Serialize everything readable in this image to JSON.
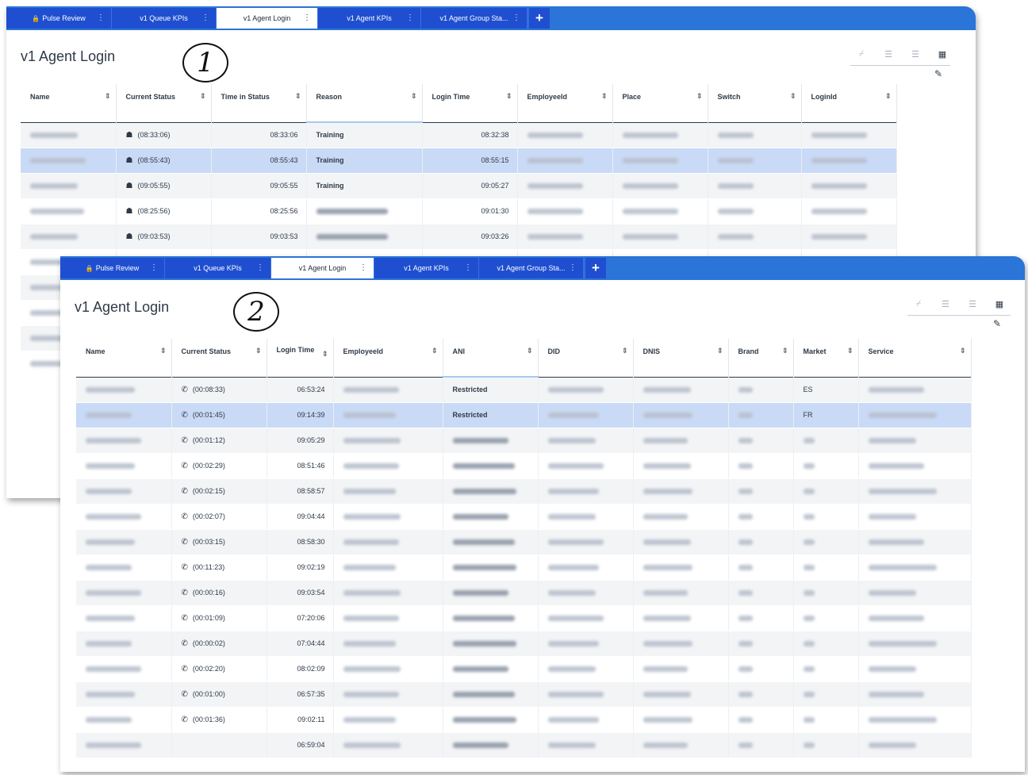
{
  "tabs": [
    {
      "label": "Pulse Review",
      "locked": true
    },
    {
      "label": "v1 Queue KPIs"
    },
    {
      "label": "v1 Agent Login",
      "active": true
    },
    {
      "label": "v1 Agent KPIs"
    },
    {
      "label": "v1 Agent Group Sta..."
    }
  ],
  "tab_add": "+",
  "tab_menu_glyph": "⋮",
  "lock_glyph": "🔒",
  "page_title": "v1 Agent Login",
  "markers": [
    "1",
    "2"
  ],
  "toolbar_icons": [
    "line-chart-icon",
    "bar-chart-icon",
    "stacked-bar-icon",
    "grid-view-icon",
    "pencil-icon"
  ],
  "panel1": {
    "columns": [
      "Name",
      "Current Status",
      "Time in Status",
      "Reason",
      "Login Time",
      "EmployeeId",
      "Place",
      "Switch",
      "LoginId"
    ],
    "rows": [
      {
        "status": "(08:33:06)",
        "time_in_status": "08:33:06",
        "reason": "Training",
        "login_time": "08:32:38"
      },
      {
        "status": "(08:55:43)",
        "time_in_status": "08:55:43",
        "reason": "Training",
        "login_time": "08:55:15",
        "selected": true
      },
      {
        "status": "(09:05:55)",
        "time_in_status": "09:05:55",
        "reason": "Training",
        "login_time": "09:05:27"
      },
      {
        "status": "(08:25:56)",
        "time_in_status": "08:25:56",
        "reason": "",
        "login_time": "09:01:30"
      },
      {
        "status": "(09:03:53)",
        "time_in_status": "09:03:53",
        "reason": "",
        "login_time": "09:03:26"
      }
    ]
  },
  "panel2": {
    "columns": [
      "Name",
      "Current Status",
      "Login Time",
      "EmployeeId",
      "ANI",
      "DID",
      "DNIS",
      "Brand",
      "Market",
      "Service"
    ],
    "rows": [
      {
        "status": "(00:08:33)",
        "login_time": "06:53:24",
        "ani": "Restricted",
        "market": "ES"
      },
      {
        "status": "(00:01:45)",
        "login_time": "09:14:39",
        "ani": "Restricted",
        "market": "FR",
        "selected": true
      },
      {
        "status": "(00:01:12)",
        "login_time": "09:05:29",
        "ani": "",
        "market": ""
      },
      {
        "status": "(00:02:29)",
        "login_time": "08:51:46",
        "ani": "",
        "market": ""
      },
      {
        "status": "(00:02:15)",
        "login_time": "08:58:57",
        "ani": "",
        "market": ""
      },
      {
        "status": "(00:02:07)",
        "login_time": "09:04:44",
        "ani": "",
        "market": ""
      },
      {
        "status": "(00:03:15)",
        "login_time": "08:58:30",
        "ani": "",
        "market": ""
      },
      {
        "status": "(00:11:23)",
        "login_time": "09:02:19",
        "ani": "",
        "market": ""
      },
      {
        "status": "(00:00:16)",
        "login_time": "09:03:54",
        "ani": "",
        "market": ""
      },
      {
        "status": "(00:01:09)",
        "login_time": "07:20:06",
        "ani": "",
        "market": ""
      },
      {
        "status": "(00:00:02)",
        "login_time": "07:04:44",
        "ani": "",
        "market": ""
      },
      {
        "status": "(00:02:20)",
        "login_time": "08:02:09",
        "ani": "",
        "market": ""
      },
      {
        "status": "(00:01:00)",
        "login_time": "06:57:35",
        "ani": "",
        "market": ""
      },
      {
        "status": "(00:01:36)",
        "login_time": "09:02:11",
        "ani": "",
        "market": ""
      },
      {
        "status": "",
        "login_time": "06:59:04",
        "ani": "",
        "market": ""
      }
    ]
  },
  "colors": {
    "tabbar": "#2b74d8",
    "tab": "#1f4fd0",
    "selected_row": "#c9daf6"
  }
}
